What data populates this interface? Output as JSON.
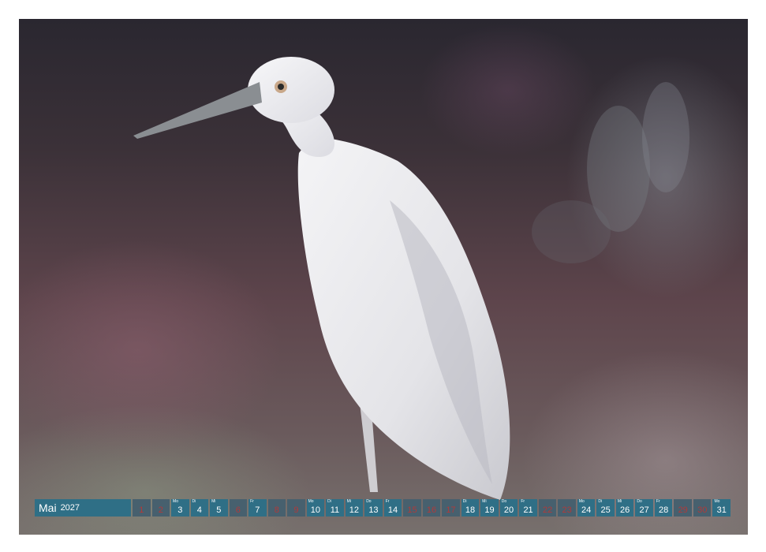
{
  "calendar": {
    "month": "Mai",
    "year": "2027",
    "days": [
      {
        "num": "1",
        "wd": "",
        "weekend": true
      },
      {
        "num": "2",
        "wd": "",
        "weekend": true
      },
      {
        "num": "3",
        "wd": "Mo",
        "weekend": false
      },
      {
        "num": "4",
        "wd": "Di",
        "weekend": false
      },
      {
        "num": "5",
        "wd": "Mi",
        "weekend": false
      },
      {
        "num": "6",
        "wd": "",
        "weekend": true
      },
      {
        "num": "7",
        "wd": "Fr",
        "weekend": false
      },
      {
        "num": "8",
        "wd": "",
        "weekend": true
      },
      {
        "num": "9",
        "wd": "",
        "weekend": true
      },
      {
        "num": "10",
        "wd": "Mo",
        "weekend": false
      },
      {
        "num": "11",
        "wd": "Di",
        "weekend": false
      },
      {
        "num": "12",
        "wd": "Mi",
        "weekend": false
      },
      {
        "num": "13",
        "wd": "Do",
        "weekend": false
      },
      {
        "num": "14",
        "wd": "Fr",
        "weekend": false
      },
      {
        "num": "15",
        "wd": "",
        "weekend": true
      },
      {
        "num": "16",
        "wd": "",
        "weekend": true
      },
      {
        "num": "17",
        "wd": "",
        "weekend": true
      },
      {
        "num": "18",
        "wd": "Di",
        "weekend": false
      },
      {
        "num": "19",
        "wd": "Mi",
        "weekend": false
      },
      {
        "num": "20",
        "wd": "Do",
        "weekend": false
      },
      {
        "num": "21",
        "wd": "Fr",
        "weekend": false
      },
      {
        "num": "22",
        "wd": "",
        "weekend": true
      },
      {
        "num": "23",
        "wd": "",
        "weekend": true
      },
      {
        "num": "24",
        "wd": "Mo",
        "weekend": false
      },
      {
        "num": "25",
        "wd": "Di",
        "weekend": false
      },
      {
        "num": "26",
        "wd": "Mi",
        "weekend": false
      },
      {
        "num": "27",
        "wd": "Do",
        "weekend": false
      },
      {
        "num": "28",
        "wd": "Fr",
        "weekend": false
      },
      {
        "num": "29",
        "wd": "",
        "weekend": true
      },
      {
        "num": "30",
        "wd": "",
        "weekend": true
      },
      {
        "num": "31",
        "wd": "Mo",
        "weekend": false
      }
    ]
  },
  "colors": {
    "bar": "#2f6f86",
    "weekend_bar": "#47606e",
    "weekend_text": "#b03a3a"
  },
  "photo": {
    "subject": "white-egret"
  }
}
